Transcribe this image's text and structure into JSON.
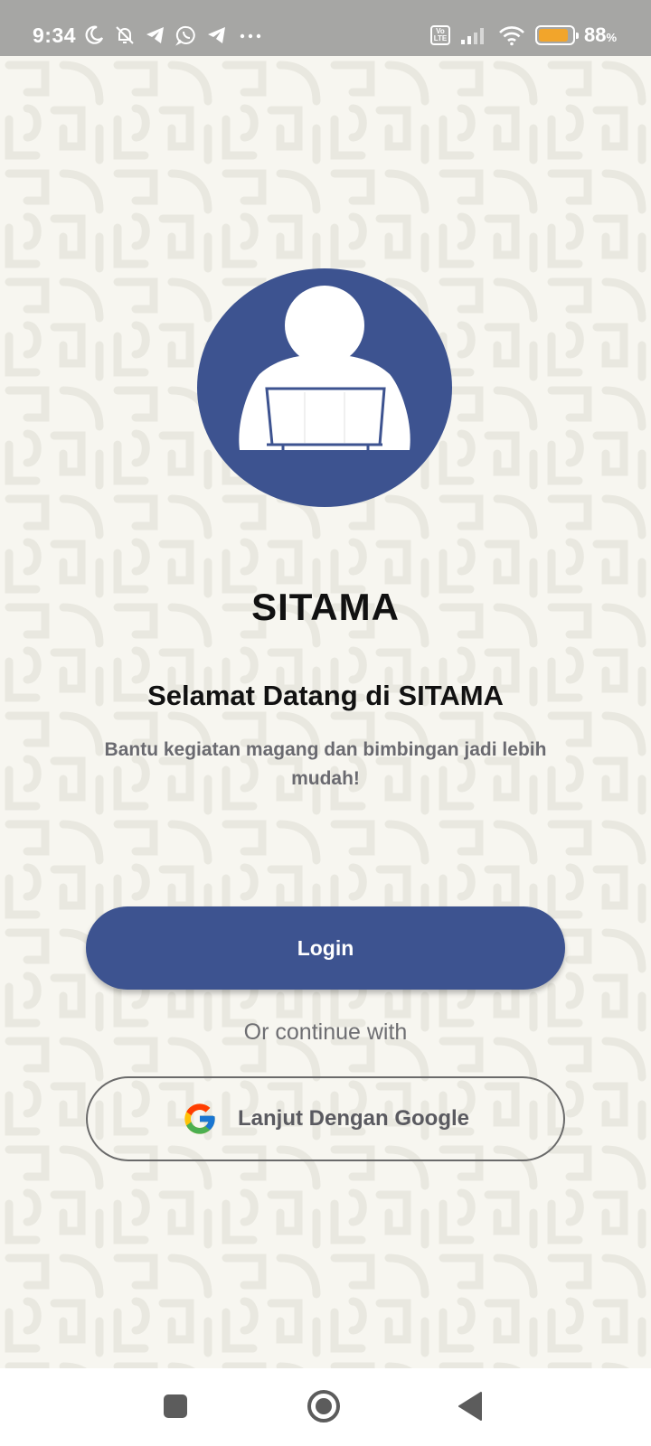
{
  "status_bar": {
    "time": "9:34",
    "battery_percent": "88",
    "battery_symbol": "%",
    "battery_level": 0.88,
    "volte": "Vo LTE",
    "icons": [
      "moon-icon",
      "bell-off-icon",
      "telegram-icon",
      "whatsapp-icon",
      "telegram-icon",
      "more-dots-icon",
      "signal-icon",
      "wifi-icon",
      "battery-icon"
    ]
  },
  "app": {
    "name": "SITAMA",
    "logo_icon": "user-laptop-icon",
    "accent_color": "#3d5390"
  },
  "welcome": {
    "title": "Selamat Datang di SITAMA",
    "subtitle": "Bantu kegiatan magang dan bimbingan jadi lebih mudah!"
  },
  "actions": {
    "login_label": "Login",
    "divider_text": "Or continue with",
    "google_label": "Lanjut Dengan Google",
    "google_icon": "google-icon"
  },
  "nav_bar": {
    "icons": [
      "recent-apps-icon",
      "home-icon",
      "back-icon"
    ]
  }
}
